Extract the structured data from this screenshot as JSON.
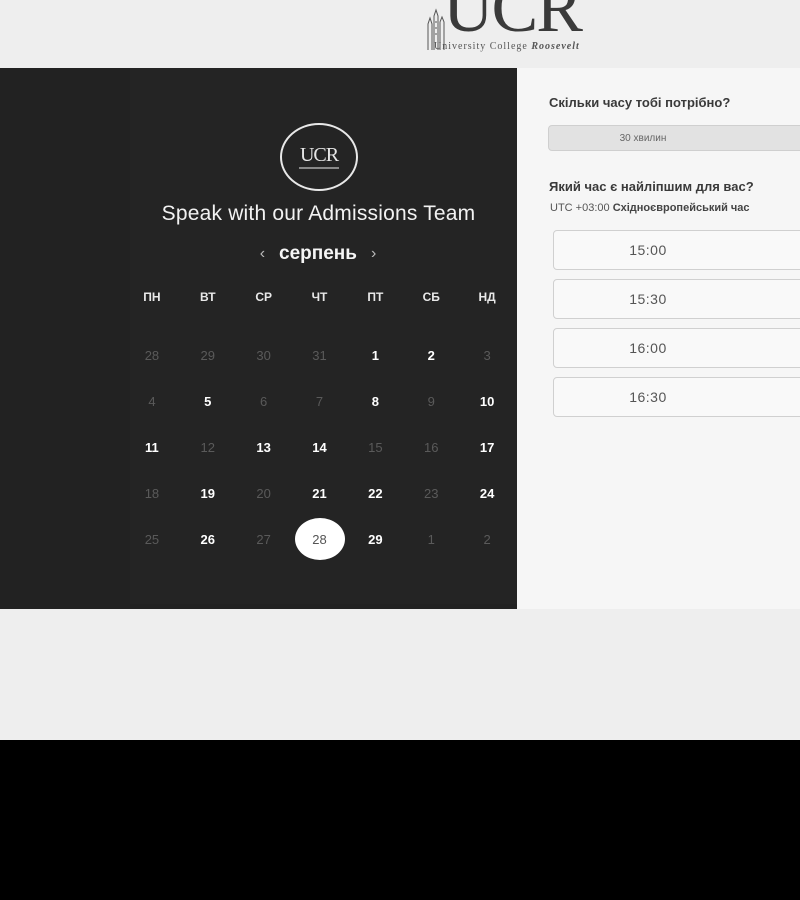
{
  "header": {
    "logo_wordmark": "UCR",
    "logo_subline_a": "University College",
    "logo_subline_b": "Roosevelt"
  },
  "scheduler": {
    "logo_wordmark": "UCR",
    "title": "Speak with our Admissions Team",
    "month": "серпень",
    "prev_arrow": "‹",
    "next_arrow": "›",
    "weekdays": [
      "ПН",
      "ВТ",
      "СР",
      "ЧТ",
      "ПТ",
      "СБ",
      "НД"
    ],
    "weeks": [
      [
        {
          "d": "28",
          "s": "muted"
        },
        {
          "d": "29",
          "s": "muted"
        },
        {
          "d": "30",
          "s": "muted"
        },
        {
          "d": "31",
          "s": "muted"
        },
        {
          "d": "1",
          "s": "active"
        },
        {
          "d": "2",
          "s": "active"
        },
        {
          "d": "3",
          "s": "muted"
        }
      ],
      [
        {
          "d": "4",
          "s": "muted"
        },
        {
          "d": "5",
          "s": "active"
        },
        {
          "d": "6",
          "s": "muted"
        },
        {
          "d": "7",
          "s": "muted"
        },
        {
          "d": "8",
          "s": "active"
        },
        {
          "d": "9",
          "s": "muted"
        },
        {
          "d": "10",
          "s": "active"
        }
      ],
      [
        {
          "d": "11",
          "s": "active"
        },
        {
          "d": "12",
          "s": "muted"
        },
        {
          "d": "13",
          "s": "active"
        },
        {
          "d": "14",
          "s": "active"
        },
        {
          "d": "15",
          "s": "muted"
        },
        {
          "d": "16",
          "s": "muted"
        },
        {
          "d": "17",
          "s": "active"
        }
      ],
      [
        {
          "d": "18",
          "s": "muted"
        },
        {
          "d": "19",
          "s": "active"
        },
        {
          "d": "20",
          "s": "muted"
        },
        {
          "d": "21",
          "s": "active"
        },
        {
          "d": "22",
          "s": "active"
        },
        {
          "d": "23",
          "s": "muted"
        },
        {
          "d": "24",
          "s": "active"
        }
      ],
      [
        {
          "d": "25",
          "s": "muted"
        },
        {
          "d": "26",
          "s": "active"
        },
        {
          "d": "27",
          "s": "muted"
        },
        {
          "d": "28",
          "s": "selected"
        },
        {
          "d": "29",
          "s": "active"
        },
        {
          "d": "1",
          "s": "muted"
        },
        {
          "d": "2",
          "s": "muted"
        }
      ]
    ]
  },
  "booking": {
    "duration_question": "Скільки часу тобі потрібно?",
    "duration_value": "30 хвилин",
    "time_question": "Який час є найліпшим для вас?",
    "timezone_offset": "UTC +03:00",
    "timezone_name": "Східноєвропейський час",
    "slots": [
      "15:00",
      "15:30",
      "16:00",
      "16:30"
    ]
  },
  "colors": {
    "panel_dark": "#222222",
    "panel_light": "#f6f6f6",
    "selected_day": "#ffffff"
  }
}
